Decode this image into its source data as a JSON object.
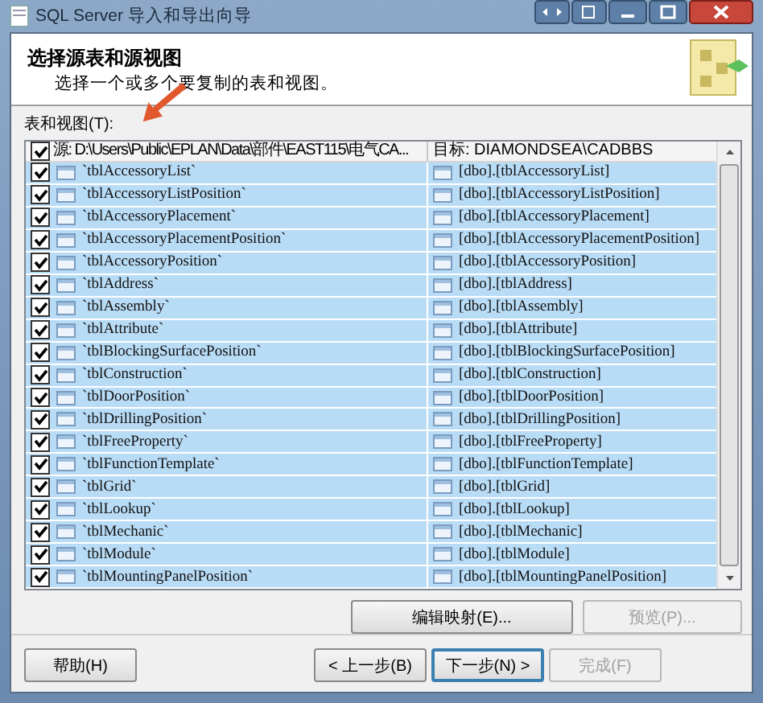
{
  "window": {
    "title": "SQL Server 导入和导出向导"
  },
  "header": {
    "title": "选择源表和源视图",
    "subtitle": "选择一个或多个要复制的表和视图。"
  },
  "tables_label": "表和视图(T):",
  "table": {
    "columns": [
      {
        "label": "源: D:\\Users\\Public\\EPLAN\\Data\\部件\\EAST115\\电气CA...",
        "checked": true
      },
      {
        "label": "目标: DIAMONDSEA\\CADBBS"
      }
    ],
    "rows": [
      {
        "source": "`tblAccessoryList`",
        "destination": "[dbo].[tblAccessoryList]",
        "checked": true,
        "selected": true
      },
      {
        "source": "`tblAccessoryListPosition`",
        "destination": "[dbo].[tblAccessoryListPosition]",
        "checked": true,
        "selected": true
      },
      {
        "source": "`tblAccessoryPlacement`",
        "destination": "[dbo].[tblAccessoryPlacement]",
        "checked": true,
        "selected": true
      },
      {
        "source": "`tblAccessoryPlacementPosition`",
        "destination": "[dbo].[tblAccessoryPlacementPosition]",
        "checked": true,
        "selected": true
      },
      {
        "source": "`tblAccessoryPosition`",
        "destination": "[dbo].[tblAccessoryPosition]",
        "checked": true,
        "selected": true
      },
      {
        "source": "`tblAddress`",
        "destination": "[dbo].[tblAddress]",
        "checked": true,
        "selected": true
      },
      {
        "source": "`tblAssembly`",
        "destination": "[dbo].[tblAssembly]",
        "checked": true,
        "selected": true
      },
      {
        "source": "`tblAttribute`",
        "destination": "[dbo].[tblAttribute]",
        "checked": true,
        "selected": true
      },
      {
        "source": "`tblBlockingSurfacePosition`",
        "destination": "[dbo].[tblBlockingSurfacePosition]",
        "checked": true,
        "selected": true
      },
      {
        "source": "`tblConstruction`",
        "destination": "[dbo].[tblConstruction]",
        "checked": true,
        "selected": true
      },
      {
        "source": "`tblDoorPosition`",
        "destination": "[dbo].[tblDoorPosition]",
        "checked": true,
        "selected": true
      },
      {
        "source": "`tblDrillingPosition`",
        "destination": "[dbo].[tblDrillingPosition]",
        "checked": true,
        "selected": true
      },
      {
        "source": "`tblFreeProperty`",
        "destination": "[dbo].[tblFreeProperty]",
        "checked": true,
        "selected": true
      },
      {
        "source": "`tblFunctionTemplate`",
        "destination": "[dbo].[tblFunctionTemplate]",
        "checked": true,
        "selected": true
      },
      {
        "source": "`tblGrid`",
        "destination": "[dbo].[tblGrid]",
        "checked": true,
        "selected": true
      },
      {
        "source": "`tblLookup`",
        "destination": "[dbo].[tblLookup]",
        "checked": true,
        "selected": true
      },
      {
        "source": "`tblMechanic`",
        "destination": "[dbo].[tblMechanic]",
        "checked": true,
        "selected": true
      },
      {
        "source": "`tblModule`",
        "destination": "[dbo].[tblModule]",
        "checked": true,
        "selected": true
      },
      {
        "source": "`tblMountingPanelPosition`",
        "destination": "[dbo].[tblMountingPanelPosition]",
        "checked": true,
        "selected": true
      }
    ]
  },
  "actions": [
    {
      "label": "编辑映射(E)...",
      "disabled": false
    },
    {
      "label": "预览(P)...",
      "disabled": true
    }
  ],
  "help_button": {
    "label": "帮助(H)",
    "disabled": false
  },
  "nav_buttons": [
    {
      "label": "< 上一步(B)",
      "disabled": false,
      "default": false
    },
    {
      "label": "下一步(N) >",
      "disabled": false,
      "default": true
    },
    {
      "label": "完成(F)",
      "disabled": true,
      "default": false
    }
  ]
}
